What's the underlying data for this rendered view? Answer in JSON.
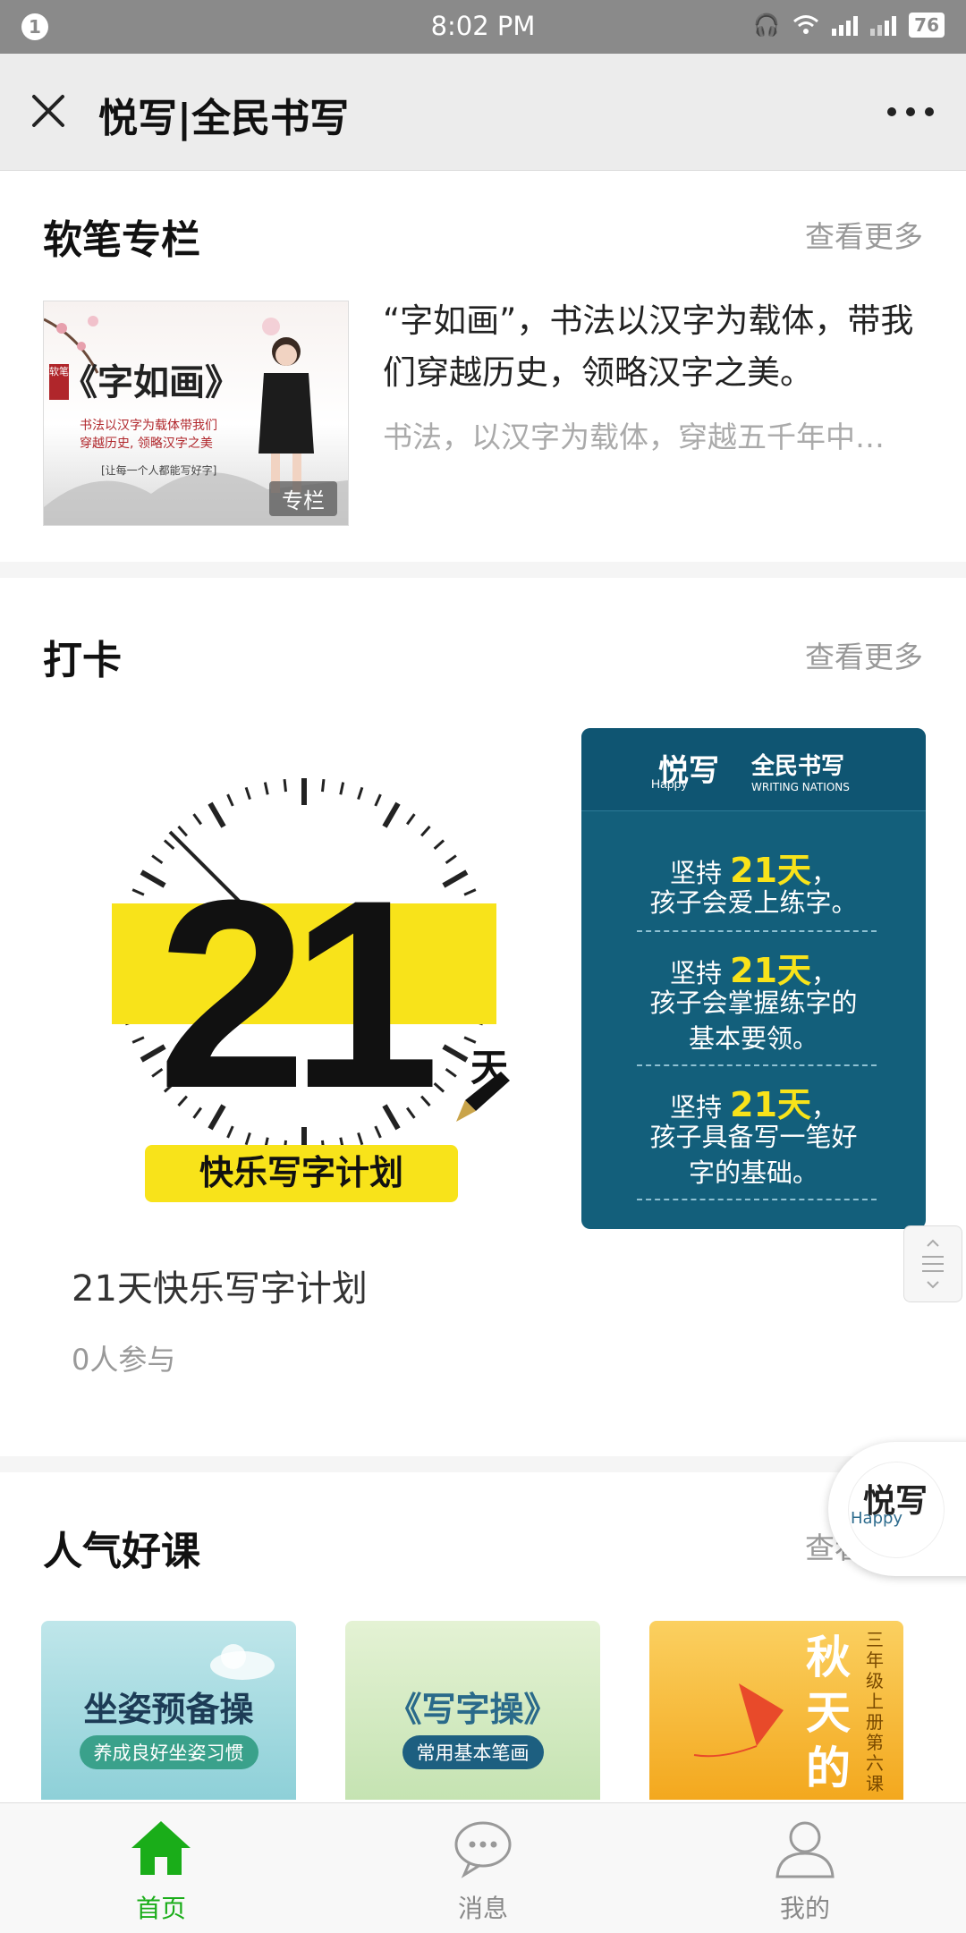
{
  "status_bar": {
    "notification_count": "1",
    "time": "8:02 PM",
    "battery": "76"
  },
  "nav": {
    "title": "悦写|全民书写"
  },
  "sections": {
    "column": {
      "title": "软笔专栏",
      "more": "查看更多",
      "thumb_title": "《字如画》",
      "thumb_line1": "书法以汉字为载体带我们",
      "thumb_line2": "穿越历史, 领略汉字之美",
      "thumb_foot": "[让每一个人都能写好字]",
      "thumb_seal": "软笔",
      "badge": "专栏",
      "headline": "“字如画”，书法以汉字为载体，带我们穿越历史，领略汉字之美。",
      "summary": "书法，以汉字为载体，穿越五千年中…"
    },
    "checkin": {
      "title": "打卡",
      "more": "查看更多",
      "clock_number": "21",
      "clock_unit": "天",
      "clock_banner": "快乐写字计划",
      "card_title": "21天快乐写字计划",
      "participants": "0人参与",
      "poster": {
        "logo": "悦写",
        "logo_en": "Happy",
        "brand": "全民书写",
        "brand_en": "WRITING NATIONS",
        "lines": [
          {
            "prefix": "坚持 ",
            "highlight": "21天",
            "suffix": "，",
            "rest": [
              "孩子会爱上练字。"
            ]
          },
          {
            "prefix": "坚持 ",
            "highlight": "21天",
            "suffix": "，",
            "rest": [
              "孩子会掌握练字的",
              "基本要领。"
            ]
          },
          {
            "prefix": "坚持 ",
            "highlight": "21天",
            "suffix": "，",
            "rest": [
              "孩子具备写一笔好",
              "字的基础。"
            ]
          }
        ]
      }
    },
    "popular": {
      "title": "人气好课",
      "more": "查看更多",
      "courses": [
        {
          "title": "坐姿预备操",
          "pill": "养成良好坐姿习惯"
        },
        {
          "title": "《写字操》",
          "pill": "常用基本笔画"
        },
        {
          "title": "秋天的雨",
          "pill": "三年级上册第六课"
        }
      ]
    }
  },
  "float_logo": {
    "text": "悦写",
    "en": "Happy"
  },
  "tabbar": [
    {
      "label": "首页",
      "icon": "home-icon",
      "active": true
    },
    {
      "label": "消息",
      "icon": "message-icon",
      "active": false
    },
    {
      "label": "我的",
      "icon": "profile-icon",
      "active": false
    }
  ],
  "colors": {
    "accent_green": "#1aad19",
    "poster_blue": "#135f7b",
    "highlight_yellow": "#f8e31a"
  }
}
